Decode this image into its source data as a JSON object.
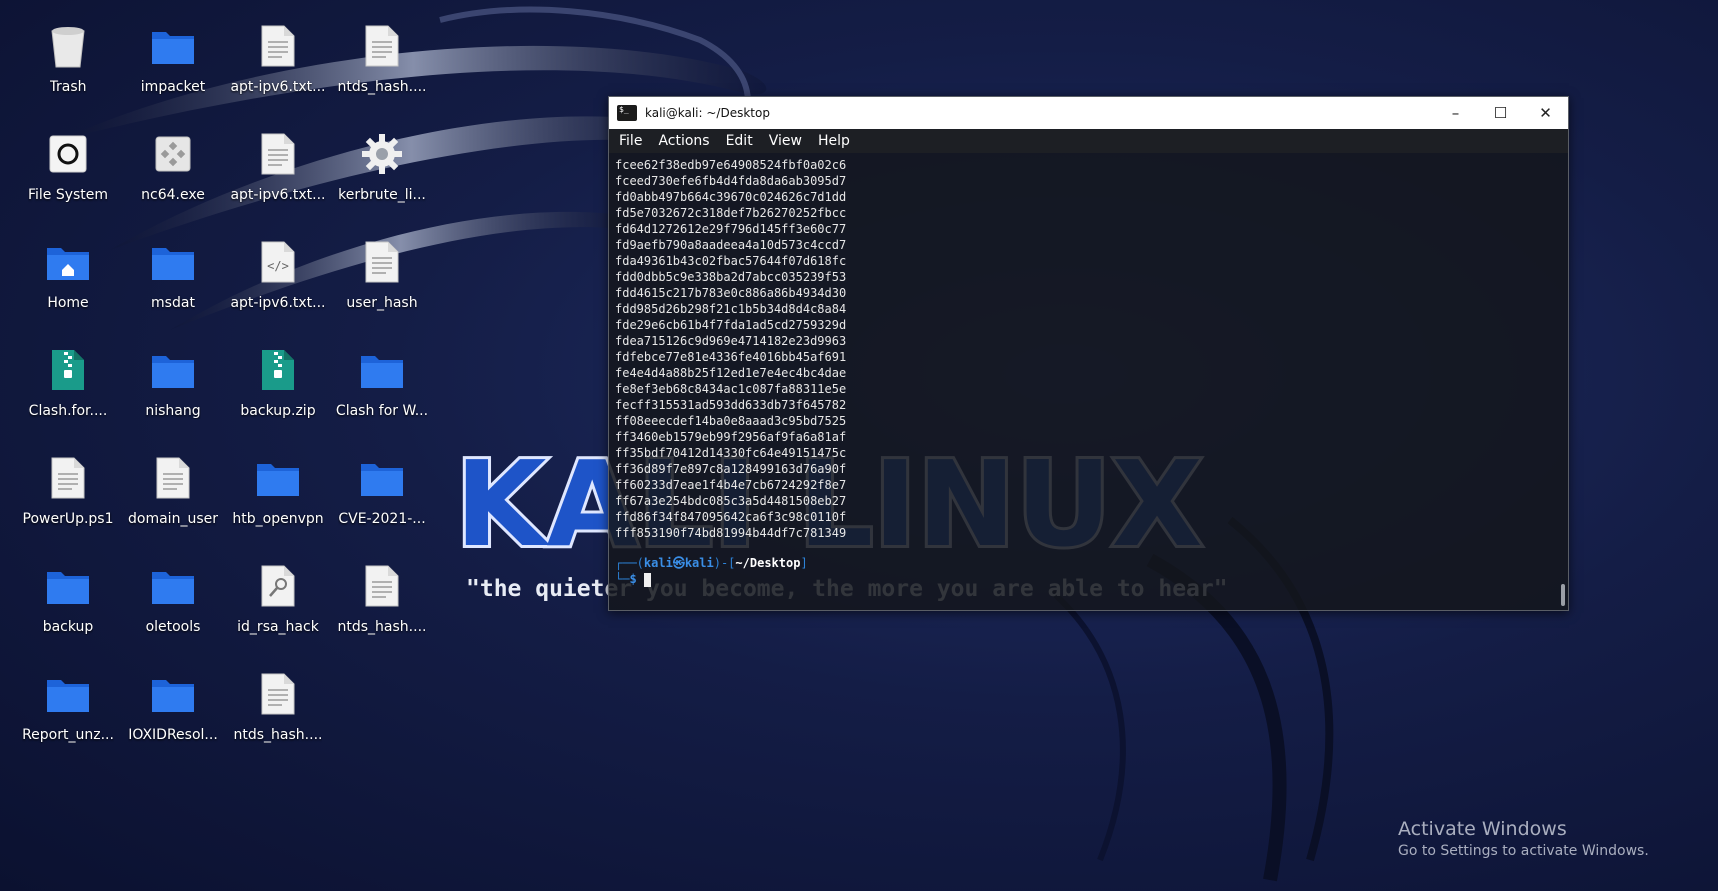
{
  "desktop": {
    "icons": [
      {
        "label": "Trash",
        "icon": "trash-icon"
      },
      {
        "label": "impacket",
        "icon": "folder-icon"
      },
      {
        "label": "apt-ipv6.txt...",
        "icon": "text-file-icon"
      },
      {
        "label": "ntds_hash....",
        "icon": "text-file-icon"
      },
      {
        "label": "File System",
        "icon": "drive-icon"
      },
      {
        "label": "nc64.exe",
        "icon": "executable-icon"
      },
      {
        "label": "apt-ipv6.txt...",
        "icon": "text-file-icon"
      },
      {
        "label": "kerbrute_li...",
        "icon": "gear-icon"
      },
      {
        "label": "Home",
        "icon": "home-folder-icon"
      },
      {
        "label": "msdat",
        "icon": "folder-icon"
      },
      {
        "label": "apt-ipv6.txt...",
        "icon": "code-file-icon"
      },
      {
        "label": "user_hash",
        "icon": "text-file-icon"
      },
      {
        "label": "Clash.for....",
        "icon": "zip-icon"
      },
      {
        "label": "nishang",
        "icon": "folder-icon"
      },
      {
        "label": "backup.zip",
        "icon": "zip-icon"
      },
      {
        "label": "Clash for W...",
        "icon": "folder-icon"
      },
      {
        "label": "PowerUp.ps1",
        "icon": "text-file-icon"
      },
      {
        "label": "domain_user",
        "icon": "text-file-icon"
      },
      {
        "label": "htb_openvpn",
        "icon": "folder-icon"
      },
      {
        "label": "CVE-2021-...",
        "icon": "folder-icon"
      },
      {
        "label": "backup",
        "icon": "folder-icon"
      },
      {
        "label": "oletools",
        "icon": "folder-icon"
      },
      {
        "label": "id_rsa_hack",
        "icon": "key-file-icon"
      },
      {
        "label": "ntds_hash....",
        "icon": "text-file-icon"
      },
      {
        "label": "Report_unz...",
        "icon": "folder-icon"
      },
      {
        "label": "IOXIDResol...",
        "icon": "folder-icon"
      },
      {
        "label": "ntds_hash....",
        "icon": "text-file-icon"
      }
    ]
  },
  "wallpaper": {
    "logo_text": "KALI LINUX",
    "tagline": "\"the quieter you become, the more you are able to hear\""
  },
  "watermark": {
    "title": "Activate Windows",
    "subtitle": "Go to Settings to activate Windows."
  },
  "terminal": {
    "title": "kali@kali: ~/Desktop",
    "menu": [
      "File",
      "Actions",
      "Edit",
      "View",
      "Help"
    ],
    "lines": [
      "fcee62f38edb97e64908524fbf0a02c6",
      "fceed730efe6fb4d4fda8da6ab3095d7",
      "fd0abb497b664c39670c024626c7d1dd",
      "fd5e7032672c318def7b26270252fbcc",
      "fd64d1272612e29f796d145ff3e60c77",
      "fd9aefb790a8aadeea4a10d573c4ccd7",
      "fda49361b43c02fbac57644f07d618fc",
      "fdd0dbb5c9e338ba2d7abcc035239f53",
      "fdd4615c217b783e0c886a86b4934d30",
      "fdd985d26b298f21c1b5b34d8d4c8a84",
      "fde29e6cb61b4f7fda1ad5cd2759329d",
      "fdea715126c9d969e4714182e23d9963",
      "fdfebce77e81e4336fe4016bb45af691",
      "fe4e4d4a88b25f12ed1e7e4ec4bc4dae",
      "fe8ef3eb68c8434ac1c087fa88311e5e",
      "fecff315531ad593dd633db73f645782",
      "ff08eeecdef14ba0e8aaad3c95bd7525",
      "ff3460eb1579eb99f2956af9fa6a81af",
      "ff35bdf70412d14330fc64e49151475c",
      "ff36d89f7e897c8a128499163d76a90f",
      "ff60233d7eae1f4b4e7cb6724292f8e7",
      "ff67a3e254bdc085c3a5d4481508eb27",
      "ffd86f34f847095642ca6f3c98c0110f",
      "fff853190f74bd81994b44df7c781349"
    ],
    "prompt": {
      "top_left": "┌──(",
      "user": "kali",
      "at": "㉿",
      "host": "kali",
      "mid": ")-[",
      "path": "~/Desktop",
      "end": "]",
      "bottom_left": "└─",
      "symbol": "$"
    }
  }
}
